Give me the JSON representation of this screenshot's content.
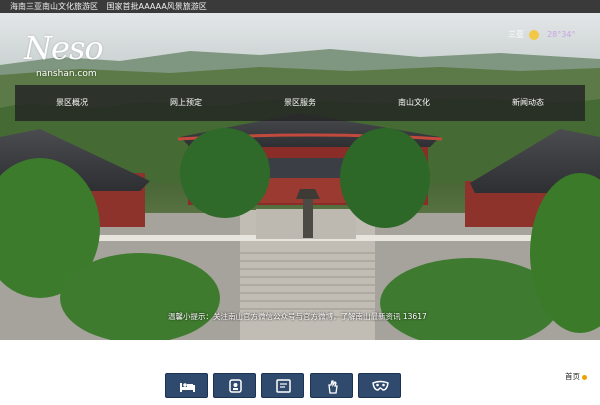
{
  "topbar": {
    "site_name": "海南三亚南山文化旅游区",
    "certification": "国家首批AAAAA风景旅游区",
    "right_link": ""
  },
  "logo": {
    "mark": "Neso",
    "domain": "nanshan.com"
  },
  "weather": {
    "city": "三亚",
    "temperature": "28°34°",
    "icon": "sun-icon"
  },
  "nav": {
    "items": [
      {
        "label": "景区概况"
      },
      {
        "label": "网上预定"
      },
      {
        "label": "景区服务"
      },
      {
        "label": "南山文化"
      },
      {
        "label": "新闻动态"
      }
    ]
  },
  "notice": {
    "text": "温馨小提示：关注南山官方微信公众号与官方微博，了解南山最新资讯 13617"
  },
  "footer": {
    "home_label": "首页"
  },
  "quick_buttons": [
    {
      "icon": "bed-icon"
    },
    {
      "icon": "service-icon"
    },
    {
      "icon": "ticket-icon"
    },
    {
      "icon": "hand-gesture-icon"
    },
    {
      "icon": "mask-icon"
    }
  ],
  "colors": {
    "topbar_bg": "#3a3a3a",
    "nav_bg": "#232323",
    "button_bg": "#2f4a6d",
    "accent_red": "#e23b2e",
    "home_dot": "#f0a000"
  }
}
